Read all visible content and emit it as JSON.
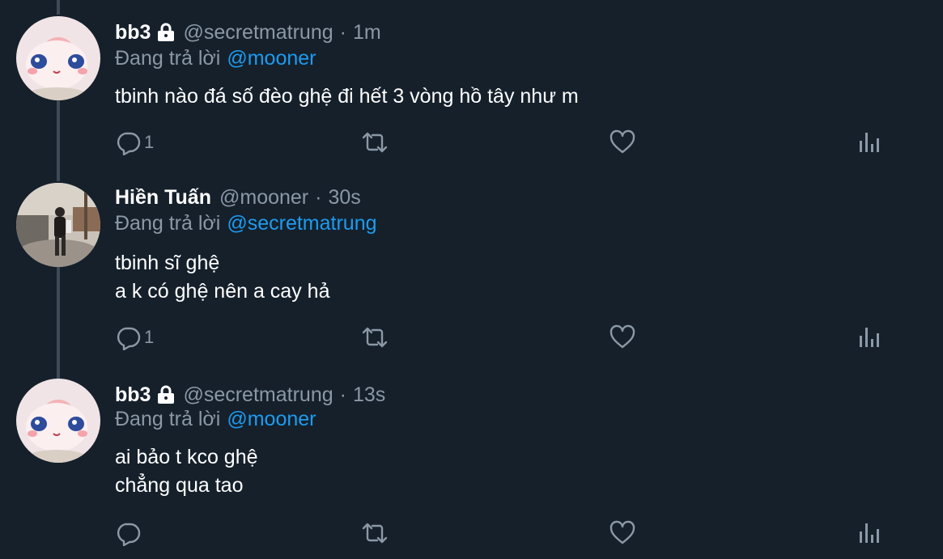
{
  "tweets": [
    {
      "name": "bb3",
      "protected": true,
      "handle": "@secretmatrung",
      "separator": "·",
      "time": "1m",
      "reply_prefix": "Đang trả lời",
      "reply_mention": "@mooner",
      "lines": [
        "tbinh nào đá số đèo ghệ đi hết 3 vòng hồ tây như m"
      ],
      "reply_count": "1",
      "avatar": "cartoon-bunny"
    },
    {
      "name": "Hiền Tuấn",
      "protected": false,
      "handle": "@mooner",
      "separator": "·",
      "time": "30s",
      "reply_prefix": "Đang trả lời",
      "reply_mention": "@secretmatrung",
      "lines": [
        "tbinh sĩ ghệ",
        "a k có ghệ nên a cay hả"
      ],
      "reply_count": "1",
      "avatar": "street-photo"
    },
    {
      "name": "bb3",
      "protected": true,
      "handle": "@secretmatrung",
      "separator": "·",
      "time": "13s",
      "reply_prefix": "Đang trả lời",
      "reply_mention": "@mooner",
      "lines": [
        "ai bảo t kco ghệ",
        "chẳng qua tao"
      ],
      "reply_count": "",
      "avatar": "cartoon-bunny"
    }
  ],
  "icons": {
    "reply": "reply-icon",
    "retweet": "retweet-icon",
    "like": "heart-icon",
    "analytics": "analytics-icon",
    "lock": "lock-icon"
  },
  "colors": {
    "background": "#15202b",
    "text": "#ffffff",
    "secondary": "#8b98a5",
    "mention": "#1d9bf0",
    "thread_line": "#3d4a57"
  }
}
